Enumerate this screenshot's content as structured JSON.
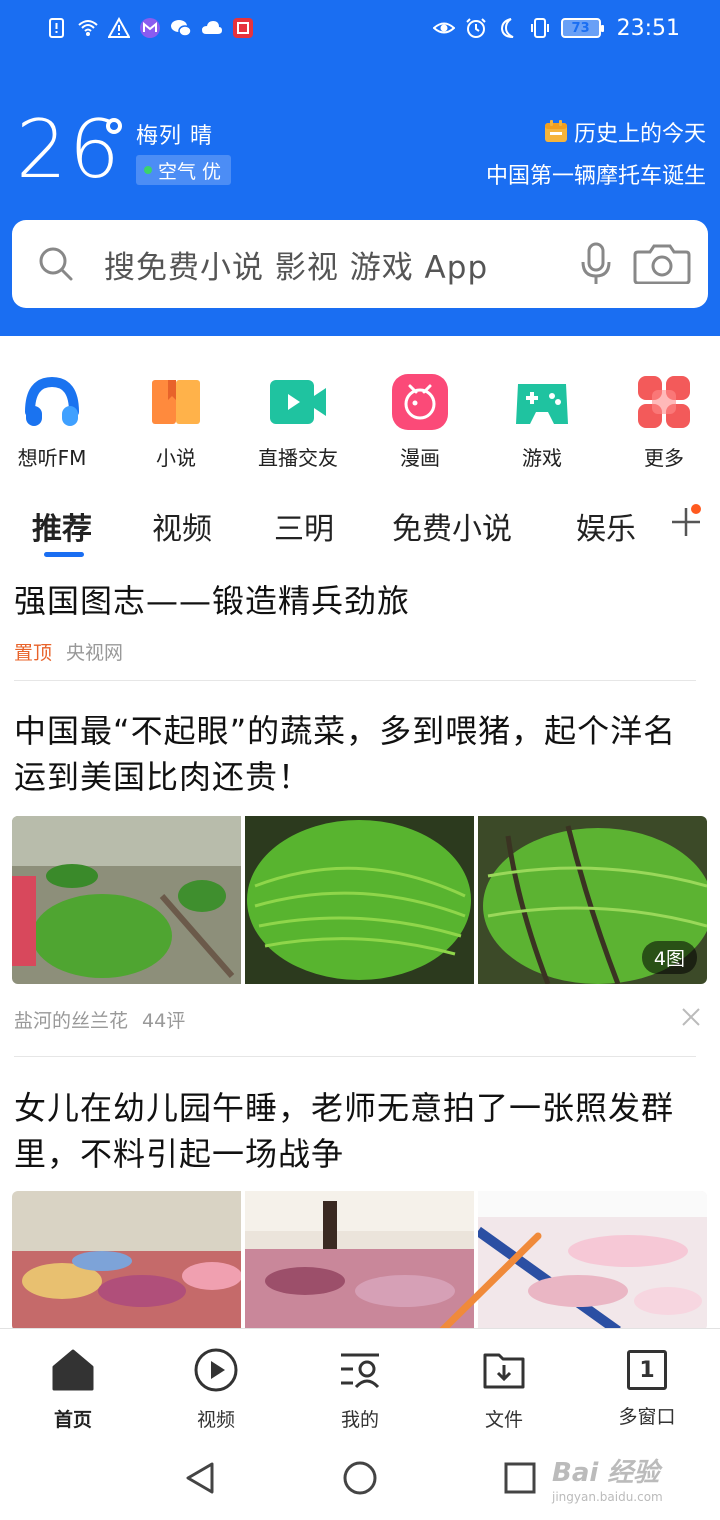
{
  "status_bar": {
    "time": "23:51",
    "battery": "73",
    "icons_left": [
      "sim-alert-icon",
      "wifi-icon",
      "warning-icon",
      "app-m-icon",
      "wechat-icon",
      "cloud-icon",
      "app-red-icon"
    ],
    "icons_right": [
      "eye-icon",
      "alarm-icon",
      "moon-icon",
      "vibrate-icon",
      "battery-icon"
    ]
  },
  "weather": {
    "temperature": "26",
    "condition": "梅列 晴",
    "air_quality": "空气 优"
  },
  "history": {
    "title": "历史上的今天",
    "subtitle": "中国第一辆摩托车诞生"
  },
  "search": {
    "placeholder": "搜免费小说 影视 游戏 App"
  },
  "shortcuts": [
    {
      "label": "想听FM",
      "icon": "headphones-icon"
    },
    {
      "label": "小说",
      "icon": "book-icon"
    },
    {
      "label": "直播交友",
      "icon": "live-video-icon"
    },
    {
      "label": "漫画",
      "icon": "comic-icon"
    },
    {
      "label": "游戏",
      "icon": "gamepad-icon"
    },
    {
      "label": "更多",
      "icon": "grid-more-icon"
    }
  ],
  "tabs": [
    {
      "label": "推荐",
      "active": true
    },
    {
      "label": "视频"
    },
    {
      "label": "三明"
    },
    {
      "label": "免费小说"
    },
    {
      "label": "娱乐"
    }
  ],
  "articles": [
    {
      "title": "强国图志——锻造精兵劲旅",
      "pin": "置顶",
      "source": "央视网"
    },
    {
      "title": "中国最“不起眼”的蔬菜，多到喂猪，起个洋名运到美国比肉还贵！",
      "source": "盐河的丝兰花",
      "comments": "44评",
      "image_count": "4图"
    },
    {
      "title": "女儿在幼儿园午睡，老师无意拍了一张照发群里，不料引起一场战争"
    }
  ],
  "bottom_nav": [
    {
      "label": "首页",
      "icon": "home-icon",
      "active": true
    },
    {
      "label": "视频",
      "icon": "play-circle-icon"
    },
    {
      "label": "我的",
      "icon": "profile-list-icon"
    },
    {
      "label": "文件",
      "icon": "download-folder-icon"
    },
    {
      "label": "多窗口",
      "icon": "window-count-icon",
      "count": "1"
    }
  ],
  "watermark": {
    "text": "Bai 经验",
    "sub": "jingyan.baidu.com"
  },
  "colors": {
    "header_blue": "#1a6ef2",
    "tab_underline": "#1a6ef2",
    "pin": "#e8632a",
    "arrow": "#f08a3a"
  }
}
